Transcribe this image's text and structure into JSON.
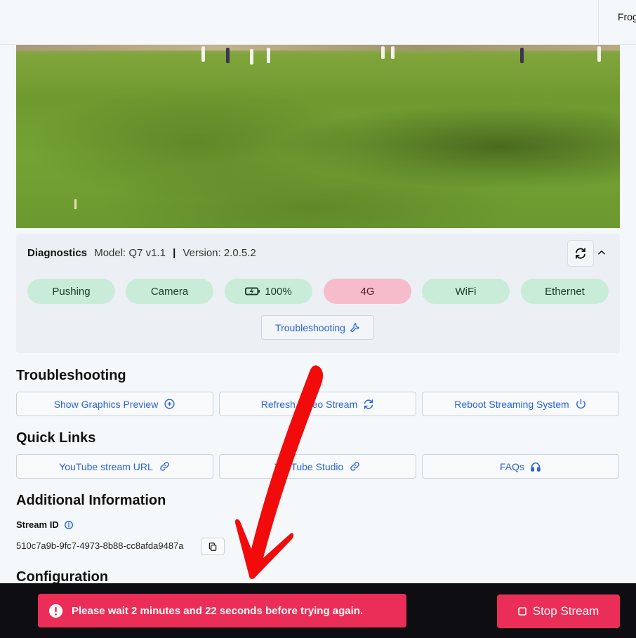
{
  "header": {
    "user_name": "Frog"
  },
  "video": {
    "description_icon": "live-video-preview"
  },
  "diagnostics": {
    "title": "Diagnostics",
    "model": "Model: Q7 v1.1",
    "separator": "|",
    "version": "Version: 2.0.5.2",
    "statuses": [
      {
        "label": "Pushing",
        "state": "ok"
      },
      {
        "label": "Camera",
        "state": "ok"
      },
      {
        "label": "100%",
        "state": "ok",
        "icon": "battery-charging-icon"
      },
      {
        "label": "4G",
        "state": "error"
      },
      {
        "label": "WiFi",
        "state": "ok"
      },
      {
        "label": "Ethernet",
        "state": "ok"
      }
    ],
    "troubleshooting_button": "Troubleshooting",
    "colors": {
      "ok": "#c9ecd9",
      "error": "#f6bccb"
    }
  },
  "troubleshooting": {
    "title": "Troubleshooting",
    "buttons": [
      {
        "label": "Show Graphics Preview",
        "icon": "plus-circle-icon"
      },
      {
        "label": "Refresh Video Stream",
        "icon": "refresh-icon"
      },
      {
        "label": "Reboot Streaming System",
        "icon": "power-icon"
      }
    ]
  },
  "quick_links": {
    "title": "Quick Links",
    "buttons": [
      {
        "label": "YouTube stream URL",
        "icon": "link-icon"
      },
      {
        "label": "YouTube Studio",
        "icon": "link-icon"
      },
      {
        "label": "FAQs",
        "icon": "headset-icon"
      }
    ]
  },
  "additional_info": {
    "title": "Additional Information",
    "stream_id_label": "Stream ID",
    "stream_id": "510c7a9b-9fc7-4973-8b88-cc8afda9487a"
  },
  "configuration": {
    "title": "Configuration"
  },
  "bottom_bar": {
    "toast_message": "Please wait 2 minutes and 22 seconds before trying again.",
    "stop_button": "Stop Stream",
    "accent": "#ea2e58"
  }
}
